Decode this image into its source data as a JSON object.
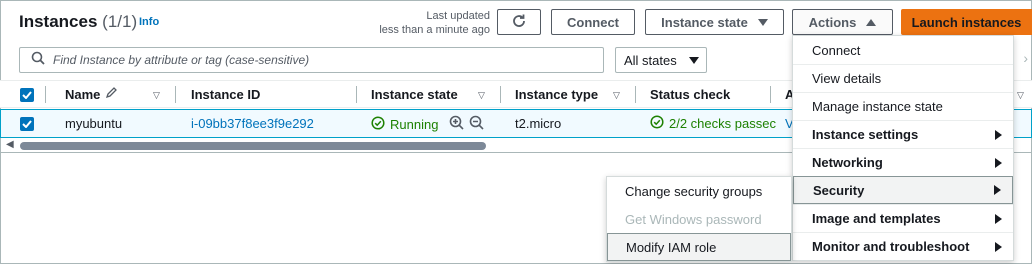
{
  "header": {
    "title": "Instances",
    "count": "(1/1)",
    "info": "Info",
    "last_updated_line1": "Last updated",
    "last_updated_line2": "less than a minute ago"
  },
  "toolbar": {
    "connect": "Connect",
    "instance_state": "Instance state",
    "actions": "Actions",
    "launch": "Launch instances"
  },
  "filter": {
    "search_placeholder": "Find Instance by attribute or tag (case-sensitive)",
    "states": "All states"
  },
  "table": {
    "columns": [
      "Name",
      "Instance ID",
      "Instance state",
      "Instance type",
      "Status check",
      "A"
    ],
    "row": {
      "name": "myubuntu",
      "instance_id": "i-09bb37f8ee3f9e292",
      "state": "Running",
      "type": "t2.micro",
      "status": "2/2 checks passec",
      "alarm": "V"
    }
  },
  "actions_menu": {
    "items": [
      {
        "label": "Connect"
      },
      {
        "label": "View details"
      },
      {
        "label": "Manage instance state"
      },
      {
        "label": "Instance settings"
      },
      {
        "label": "Networking"
      },
      {
        "label": "Security"
      },
      {
        "label": "Image and templates"
      },
      {
        "label": "Monitor and troubleshoot"
      }
    ]
  },
  "security_submenu": {
    "items": [
      {
        "label": "Change security groups"
      },
      {
        "label": "Get Windows password"
      },
      {
        "label": "Modify IAM role"
      }
    ]
  },
  "colors": {
    "accent": "#0073bb",
    "launch": "#ec7211",
    "success": "#1d8102"
  }
}
